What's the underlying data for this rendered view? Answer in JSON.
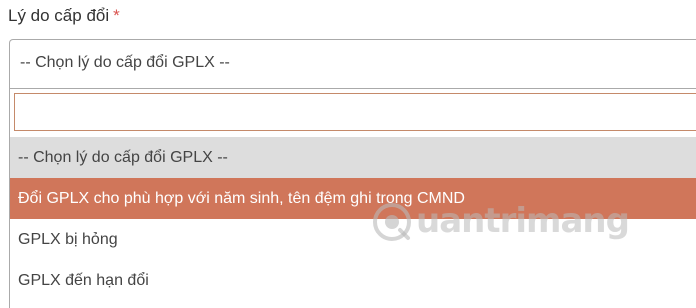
{
  "form": {
    "label": "Lý do cấp đổi",
    "required_mark": "*"
  },
  "select": {
    "selected_value": "-- Chọn lý do cấp đổi GPLX --",
    "search_value": "",
    "options": [
      "-- Chọn lý do cấp đổi GPLX --",
      "Đổi GPLX cho phù hợp với năm sinh, tên đệm ghi trong CMND",
      "GPLX bị hỏng",
      "GPLX đến hạn đổi"
    ],
    "highlighted_index": 1
  },
  "watermark": {
    "text": "uantrimang",
    "icon": "quantrimang-logo-icon"
  },
  "colors": {
    "highlight": "#d0765a",
    "placeholder_bg": "#dddddd",
    "required": "#d9534f",
    "search_border": "#c58a6a"
  }
}
